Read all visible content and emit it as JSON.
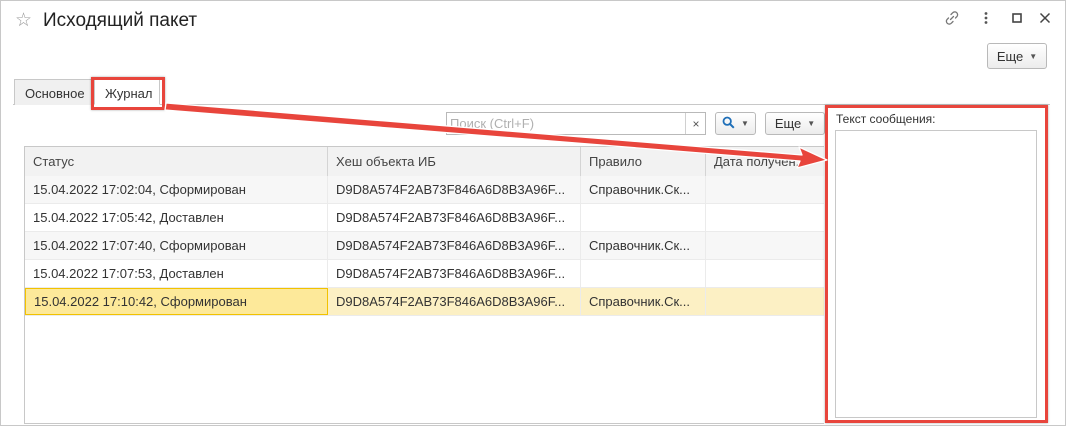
{
  "window": {
    "title": "Исходящий пакет",
    "icons": [
      "star-icon",
      "link-icon",
      "more-vertical-icon",
      "maximize-icon",
      "close-icon"
    ]
  },
  "top_more_button": "Еще",
  "tabs": [
    {
      "label": "Основное",
      "active": false
    },
    {
      "label": "Журнал",
      "active": true
    }
  ],
  "toolbar": {
    "search_placeholder": "Поиск (Ctrl+F)",
    "more_label": "Еще",
    "clear_glyph": "×",
    "search_icon": "magnifier-icon"
  },
  "table": {
    "columns": [
      "Статус",
      "Хеш объекта ИБ",
      "Правило",
      "Дата получен..."
    ],
    "rows": [
      {
        "status": "15.04.2022 17:02:04, Сформирован",
        "hash": "D9D8A574F2AB73F846A6D8B3A96F...",
        "rule": "Справочник.Ск...",
        "date": ""
      },
      {
        "status": "15.04.2022 17:05:42, Доставлен",
        "hash": "D9D8A574F2AB73F846A6D8B3A96F...",
        "rule": "",
        "date": ""
      },
      {
        "status": "15.04.2022 17:07:40, Сформирован",
        "hash": "D9D8A574F2AB73F846A6D8B3A96F...",
        "rule": "Справочник.Ск...",
        "date": ""
      },
      {
        "status": "15.04.2022 17:07:53, Доставлен",
        "hash": "D9D8A574F2AB73F846A6D8B3A96F...",
        "rule": "",
        "date": ""
      },
      {
        "status": "15.04.2022 17:10:42, Сформирован",
        "hash": "D9D8A574F2AB73F846A6D8B3A96F...",
        "rule": "Справочник.Ск...",
        "date": ""
      }
    ],
    "selected_row": 4
  },
  "message_panel": {
    "label": "Текст сообщения:",
    "value": ""
  },
  "colors": {
    "annotation_red": "#e8453c",
    "selection_row": "#fcf0c4",
    "selection_cell": "#fde99a",
    "search_icon_blue": "#1f6fb8"
  }
}
